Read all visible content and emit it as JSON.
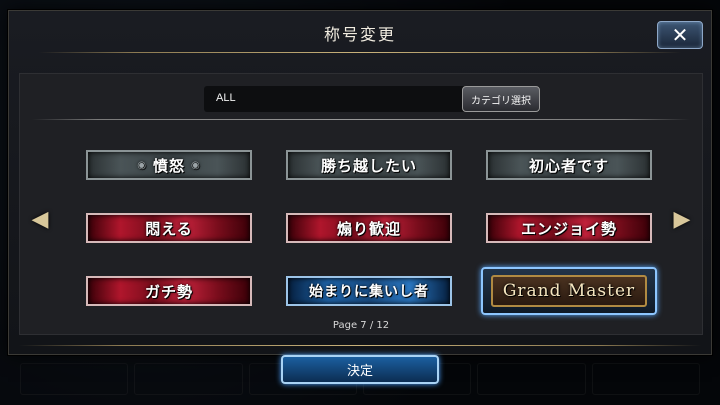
{
  "modal": {
    "title": "称号変更",
    "close_label": "✕"
  },
  "filter": {
    "current_value": "ALL",
    "category_button_label": "カテゴリ選択"
  },
  "titles": [
    {
      "label": "憤怒",
      "style": "grey",
      "selected": false
    },
    {
      "label": "勝ち越したい",
      "style": "grey",
      "selected": false
    },
    {
      "label": "初心者です",
      "style": "grey",
      "selected": false
    },
    {
      "label": "悶える",
      "style": "red",
      "selected": false
    },
    {
      "label": "煽り歓迎",
      "style": "red",
      "selected": false
    },
    {
      "label": "エンジョイ勢",
      "style": "red",
      "selected": false
    },
    {
      "label": "ガチ勢",
      "style": "red",
      "selected": false
    },
    {
      "label": "始まりに集いし者",
      "style": "blue",
      "selected": false
    },
    {
      "label": "Grand Master",
      "style": "gold",
      "selected": true
    }
  ],
  "pagination": {
    "label": "Page  7 / 12",
    "current": 7,
    "total": 12
  },
  "confirm_button_label": "決定",
  "icons": {
    "prev": "chevron-left-icon",
    "next": "chevron-right-icon",
    "close": "close-icon"
  },
  "colors": {
    "accent_blue": "#1b5fa0",
    "gold": "#c9b27a",
    "red_plate": "#b0162c"
  }
}
